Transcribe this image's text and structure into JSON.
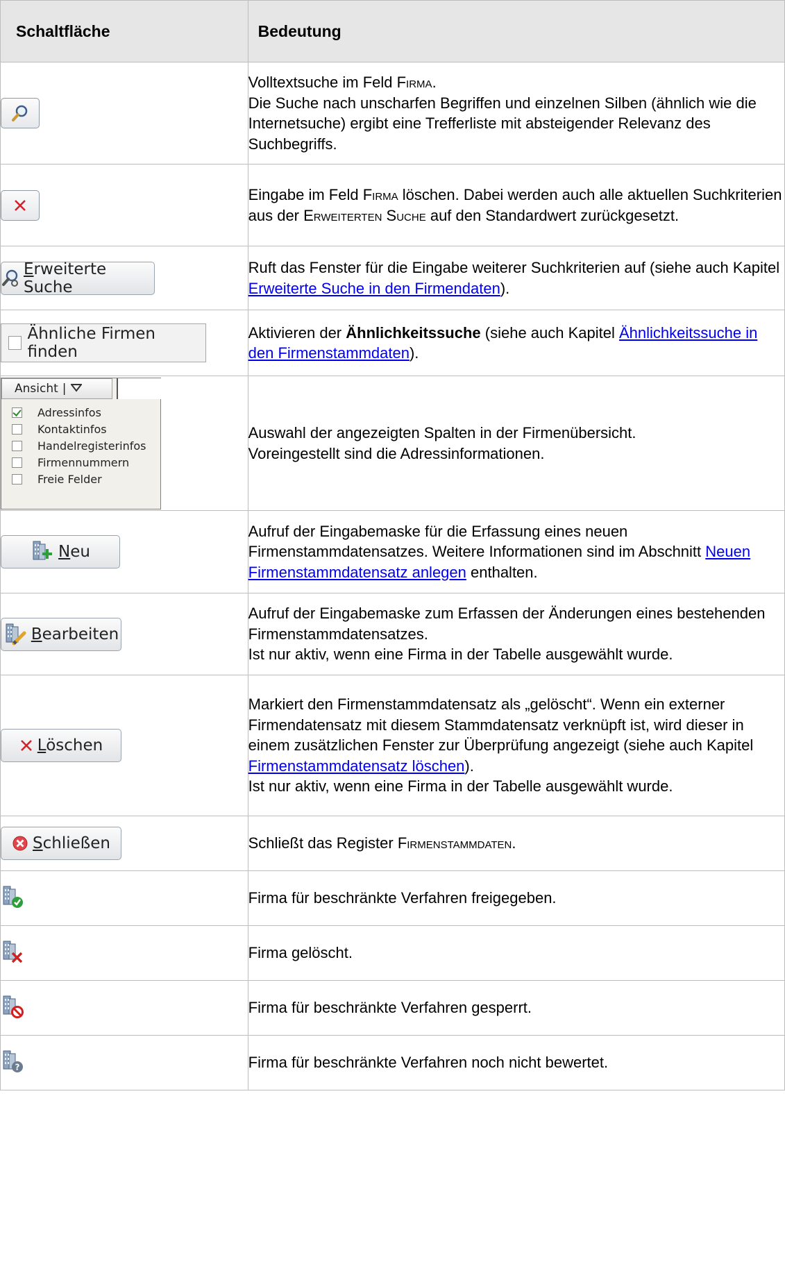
{
  "header": {
    "col1": "Schaltfläche",
    "col2": "Bedeutung"
  },
  "rows": [
    {
      "button": {
        "type": "icon",
        "icon": "magnifier-icon"
      },
      "text": [
        {
          "t": "Volltextsuche im Feld "
        },
        {
          "sc": "Firma"
        },
        {
          "t": "."
        },
        {
          "br": true
        },
        {
          "t": "Die Suche nach unscharfen Begriffen und einzelnen Silben (ähnlich wie die Internetsuche) ergibt eine Trefferliste mit absteigender Relevanz des Suchbegriffs."
        }
      ]
    },
    {
      "button": {
        "type": "icon",
        "icon": "close-x-icon"
      },
      "text": [
        {
          "t": "Eingabe im Feld "
        },
        {
          "sc": "Firma"
        },
        {
          "t": " löschen. Dabei werden auch alle aktuellen Suchkriterien aus der "
        },
        {
          "sc": "Erweiterten Suche"
        },
        {
          "t": " auf den Standardwert zurückgesetzt."
        }
      ]
    },
    {
      "button": {
        "type": "label",
        "label": "Erweiterte Suche",
        "icon": "advanced-search-icon"
      },
      "text": [
        {
          "t": "Ruft das Fenster für die Eingabe weiterer Suchkriterien auf (siehe auch Kapitel "
        },
        {
          "link": "Erweiterte Suche in den Firmendaten"
        },
        {
          "t": ")."
        }
      ]
    },
    {
      "button": {
        "type": "checkbox",
        "label": "Ähnliche Firmen finden"
      },
      "text": [
        {
          "t": "Aktivieren der "
        },
        {
          "b": "Ähnlichkeitssuche"
        },
        {
          "t": " (siehe auch Kapitel "
        },
        {
          "link": "Ähnlichkeitssuche in den Firmenstammdaten"
        },
        {
          "t": ")."
        }
      ]
    },
    {
      "button": {
        "type": "menu",
        "label": "Ansicht",
        "separator": "|",
        "items": [
          {
            "label": "Adressinfos",
            "checked": true
          },
          {
            "label": "Kontaktinfos",
            "checked": false
          },
          {
            "label": "Handelregisterinfos",
            "checked": false
          },
          {
            "label": "Firmennummern",
            "checked": false
          },
          {
            "label": "Freie Felder",
            "checked": false
          }
        ]
      },
      "text": [
        {
          "t": "Auswahl der angezeigten Spalten in der Firmenübersicht."
        },
        {
          "br": true
        },
        {
          "t": "Voreingestellt sind die Adressinformationen."
        }
      ]
    },
    {
      "button": {
        "type": "label",
        "label": "Neu",
        "icon": "building-add-icon"
      },
      "text": [
        {
          "t": "Aufruf der Eingabemaske für die Erfassung eines neuen Firmenstammdatensatzes. Weitere Informationen sind im Abschnitt "
        },
        {
          "link": "Neuen Firmenstammdatensatz anlegen"
        },
        {
          "t": " enthalten."
        }
      ]
    },
    {
      "button": {
        "type": "label",
        "label": "Bearbeiten",
        "icon": "building-edit-icon"
      },
      "text": [
        {
          "t": "Aufruf der Eingabemaske zum Erfassen der Änderungen eines bestehenden Firmenstammdatensatzes."
        },
        {
          "br": true
        },
        {
          "t": "Ist nur aktiv, wenn eine Firma in der Tabelle ausgewählt wurde."
        }
      ]
    },
    {
      "button": {
        "type": "label",
        "label": "Löschen",
        "icon": "delete-x-icon"
      },
      "text": [
        {
          "t": "Markiert den Firmenstammdatensatz als „gelöscht“. Wenn ein externer Firmendatensatz mit diesem Stammdatensatz verknüpft ist, wird dieser in einem zusätzlichen Fenster zur Überprüfung angezeigt (siehe auch Kapitel "
        },
        {
          "link": "Firmenstammdatensatz löschen"
        },
        {
          "t": ")."
        },
        {
          "br": true
        },
        {
          "t": "Ist nur aktiv, wenn eine Firma in der Tabelle ausgewählt wurde."
        }
      ]
    },
    {
      "button": {
        "type": "label",
        "label": "Schließen",
        "icon": "close-circle-icon"
      },
      "text": [
        {
          "t": "Schließt das Register "
        },
        {
          "sc": "Firmenstammdaten"
        },
        {
          "t": "."
        }
      ]
    },
    {
      "button": {
        "type": "status",
        "icon": "building-approved-icon",
        "badge": "#2e9e3a"
      },
      "text": [
        {
          "t": "Firma für beschränkte Verfahren freigegeben."
        }
      ]
    },
    {
      "button": {
        "type": "status",
        "icon": "building-deleted-icon",
        "badge": "#d21f1f"
      },
      "text": [
        {
          "t": "Firma gelöscht."
        }
      ]
    },
    {
      "button": {
        "type": "status",
        "icon": "building-blocked-icon",
        "badge": "#d21f1f"
      },
      "text": [
        {
          "t": "Firma für beschränkte Verfahren gesperrt."
        }
      ]
    },
    {
      "button": {
        "type": "status",
        "icon": "building-unrated-icon",
        "badge": "#6b7c8f"
      },
      "text": [
        {
          "t": "Firma für beschränkte Verfahren noch nicht bewertet."
        }
      ]
    }
  ],
  "colors": {
    "border": "#bdbdbd",
    "header_bg": "#e6e6e6",
    "link": "#0000ee"
  }
}
